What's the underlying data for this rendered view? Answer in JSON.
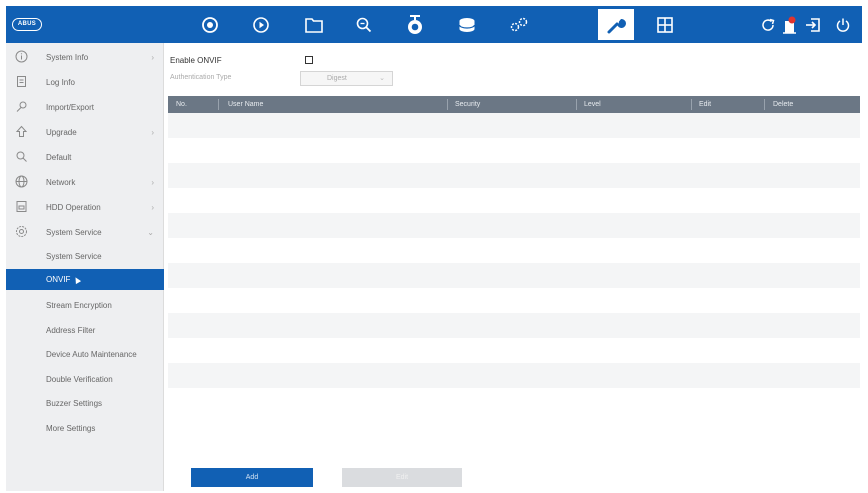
{
  "brand": {
    "logo_text": "ABUS"
  },
  "toolbar": {
    "icons": [
      {
        "name": "live-view-icon"
      },
      {
        "name": "playback-icon"
      },
      {
        "name": "file-manager-icon"
      },
      {
        "name": "search-icon"
      },
      {
        "name": "camera-icon"
      },
      {
        "name": "storage-icon"
      },
      {
        "name": "configuration-icon"
      },
      {
        "name": "maintenance-icon",
        "active": true
      },
      {
        "name": "display-layout-icon"
      },
      {
        "name": "refresh-icon"
      },
      {
        "name": "alarm-icon"
      },
      {
        "name": "logout-icon"
      },
      {
        "name": "power-icon"
      }
    ]
  },
  "sidebar": {
    "items": [
      {
        "label": "System Info",
        "icon": "info-icon",
        "has_arrow": true
      },
      {
        "label": "Log Info",
        "icon": "log-icon",
        "has_arrow": false
      },
      {
        "label": "Import/Export",
        "icon": "import-export-icon",
        "has_arrow": false
      },
      {
        "label": "Upgrade",
        "icon": "upgrade-icon",
        "has_arrow": true
      },
      {
        "label": "Default",
        "icon": "default-icon",
        "has_arrow": false
      },
      {
        "label": "Network",
        "icon": "network-icon",
        "has_arrow": true
      },
      {
        "label": "HDD Operation",
        "icon": "hdd-icon",
        "has_arrow": true
      },
      {
        "label": "System Service",
        "icon": "system-service-icon",
        "has_arrow": true,
        "expanded": true
      }
    ],
    "subitems": [
      {
        "label": "System Service"
      },
      {
        "label": "ONVIF",
        "selected": true
      },
      {
        "label": "Stream Encryption"
      },
      {
        "label": "Address Filter"
      },
      {
        "label": "Device Auto Maintenance"
      },
      {
        "label": "Double Verification"
      },
      {
        "label": "Buzzer Settings"
      },
      {
        "label": "More Settings"
      }
    ]
  },
  "form": {
    "enable_label": "Enable ONVIF",
    "enable_checked": false,
    "auth_label": "Authentication Type",
    "auth_value": "Digest"
  },
  "table": {
    "columns": [
      "No.",
      "User Name",
      "Security",
      "Level",
      "Edit",
      "Delete"
    ],
    "rows": []
  },
  "buttons": {
    "add": "Add",
    "edit": "Edit"
  },
  "colors": {
    "accent": "#1160b4",
    "table_header": "#6b7785"
  }
}
